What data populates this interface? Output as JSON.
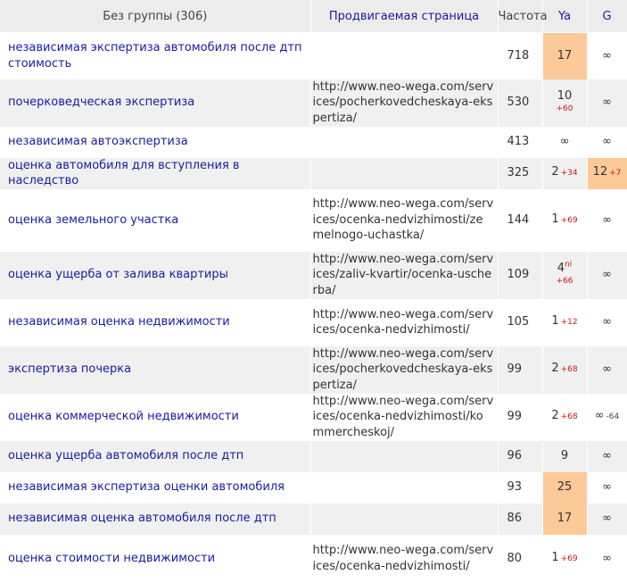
{
  "header": {
    "group_label": "Без группы (306)",
    "page_label": "Продвигаемая страница",
    "freq_label": "Частота",
    "ya_label": "Ya",
    "g_label": "G"
  },
  "rows": [
    {
      "keyword": "независимая экспертиза автомобиля после дтп стоимость",
      "url": "",
      "freq": "718",
      "ya": "17",
      "ya_delta": "",
      "ya_ni": "",
      "g": "∞",
      "g_delta": ""
    },
    {
      "keyword": "почерковедческая экспертиза",
      "url": "http://www.neo-wega.com/services/pocherkovedcheskaya-ekspertiza/",
      "freq": "530",
      "ya": "10",
      "ya_delta": "+60",
      "ya_ni": "",
      "g": "∞",
      "g_delta": ""
    },
    {
      "keyword": "независимая автоэкспертиза",
      "url": "",
      "freq": "413",
      "ya": "∞",
      "ya_delta": "",
      "ya_ni": "",
      "g": "∞",
      "g_delta": ""
    },
    {
      "keyword": "оценка автомобиля для вступления в наследство",
      "url": "",
      "freq": "325",
      "ya": "2",
      "ya_delta": "+34",
      "ya_ni": "",
      "g": "12",
      "g_delta": "+7"
    },
    {
      "keyword": "оценка земельного участка",
      "url": "http://www.neo-wega.com/services/ocenka-nedvizhimosti/zemelnogo-uchastka/",
      "freq": "144",
      "ya": "1",
      "ya_delta": "+69",
      "ya_ni": "",
      "g": "∞",
      "g_delta": ""
    },
    {
      "keyword": "оценка ущерба от залива квартиры",
      "url": "http://www.neo-wega.com/services/zaliv-kvartir/ocenka-uscherba/",
      "freq": "109",
      "ya": "4",
      "ya_delta": "+66",
      "ya_ni": "ni",
      "g": "∞",
      "g_delta": ""
    },
    {
      "keyword": "независимая оценка недвижимости",
      "url": "http://www.neo-wega.com/services/ocenka-nedvizhimosti/",
      "freq": "105",
      "ya": "1",
      "ya_delta": "+12",
      "ya_ni": "",
      "g": "∞",
      "g_delta": ""
    },
    {
      "keyword": "экспертиза почерка",
      "url": "http://www.neo-wega.com/services/pocherkovedcheskaya-ekspertiza/",
      "freq": "99",
      "ya": "2",
      "ya_delta": "+68",
      "ya_ni": "",
      "g": "∞",
      "g_delta": ""
    },
    {
      "keyword": "оценка коммерческой недвижимости",
      "url": "http://www.neo-wega.com/services/ocenka-nedvizhimosti/kommercheskoj/",
      "freq": "99",
      "ya": "2",
      "ya_delta": "+68",
      "ya_ni": "",
      "g": "∞",
      "g_delta": "-64"
    },
    {
      "keyword": "оценка ущерба автомобиля после дтп",
      "url": "",
      "freq": "96",
      "ya": "9",
      "ya_delta": "",
      "ya_ni": "",
      "g": "∞",
      "g_delta": ""
    },
    {
      "keyword": "независимая экспертиза оценки автомобиля",
      "url": "",
      "freq": "93",
      "ya": "25",
      "ya_delta": "",
      "ya_ni": "",
      "g": "∞",
      "g_delta": ""
    },
    {
      "keyword": "независимая оценка автомобиля после дтп",
      "url": "",
      "freq": "86",
      "ya": "17",
      "ya_delta": "",
      "ya_ni": "",
      "g": "∞",
      "g_delta": ""
    },
    {
      "keyword": "оценка стоимости недвижимости",
      "url": "http://www.neo-wega.com/services/ocenka-nedvizhimosti/",
      "freq": "80",
      "ya": "1",
      "ya_delta": "+69",
      "ya_ni": "",
      "g": "∞",
      "g_delta": ""
    }
  ],
  "highlight_color": "#fcc999",
  "delta_color": "#d21414",
  "link_color": "#1a1aa8"
}
